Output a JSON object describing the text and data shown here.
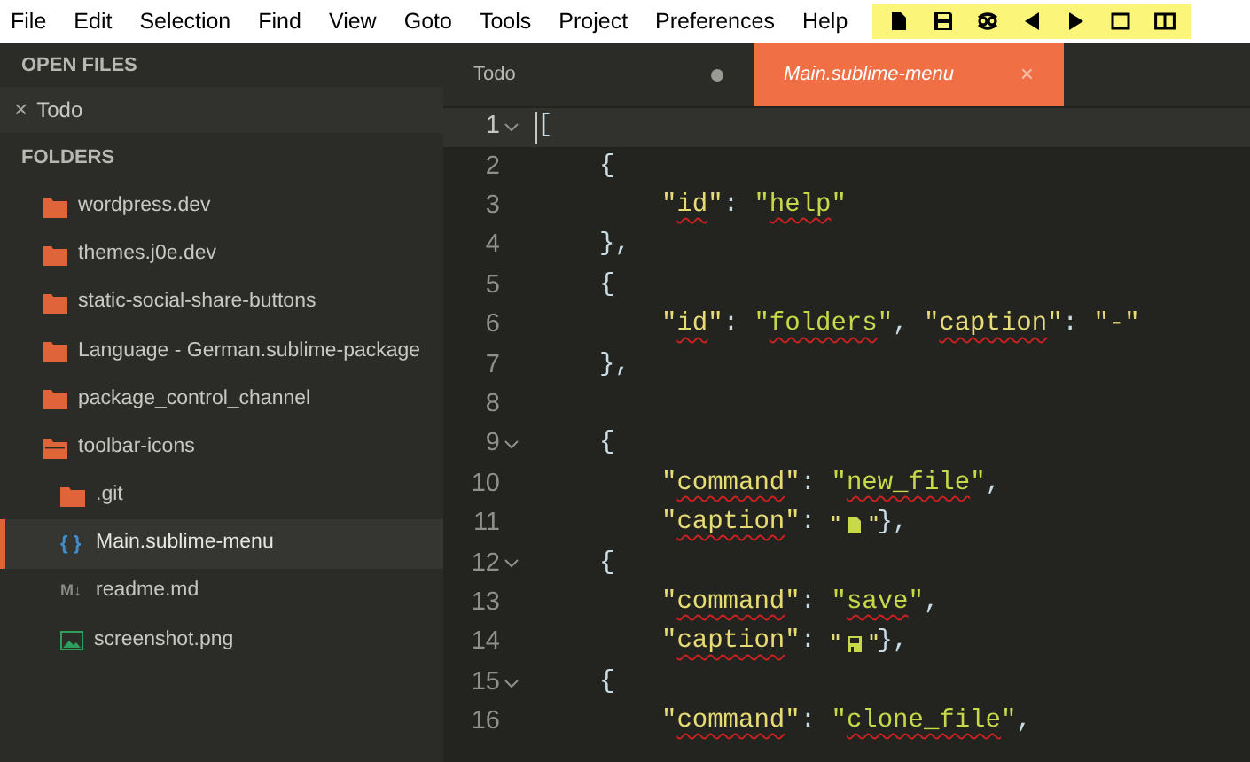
{
  "menu": [
    "File",
    "Edit",
    "Selection",
    "Find",
    "View",
    "Goto",
    "Tools",
    "Project",
    "Preferences",
    "Help"
  ],
  "toolbar": [
    {
      "kind": "new"
    },
    {
      "kind": "save"
    },
    {
      "kind": "clone"
    },
    {
      "kind": "prev"
    },
    {
      "kind": "next"
    },
    {
      "kind": "single"
    },
    {
      "kind": "split"
    }
  ],
  "sidebar": {
    "open_files_title": "OPEN FILES",
    "open_files": [
      {
        "close": "×",
        "name": "Todo"
      }
    ],
    "folders_title": "FOLDERS",
    "tree": [
      {
        "kind": "folder",
        "name": "wordpress.dev",
        "expanded": false,
        "selected": false
      },
      {
        "kind": "folder",
        "name": "themes.j0e.dev",
        "expanded": false,
        "selected": false
      },
      {
        "kind": "folder",
        "name": "static-social-share-buttons",
        "expanded": false,
        "selected": false
      },
      {
        "kind": "folder",
        "name": "Language - German.sublime-package",
        "expanded": false,
        "selected": false
      },
      {
        "kind": "folder",
        "name": "package_control_channel",
        "expanded": false,
        "selected": false
      },
      {
        "kind": "folder",
        "name": "toolbar-icons",
        "expanded": true,
        "selected": false,
        "children": [
          {
            "kind": "folder",
            "name": ".git",
            "expanded": false,
            "selected": false
          },
          {
            "kind": "code-file",
            "glyph": "{ }",
            "name": "Main.sublime-menu",
            "selected": true
          },
          {
            "kind": "markdown-file",
            "glyph": "M↓",
            "name": "readme.md",
            "selected": false
          },
          {
            "kind": "image-file",
            "name": "screenshot.png",
            "selected": false
          }
        ]
      }
    ]
  },
  "tabs": [
    {
      "label": "Todo",
      "selected": false,
      "modified": true
    },
    {
      "label": "Main.sublime-menu",
      "selected": true,
      "close": "×"
    }
  ],
  "editor": {
    "lines": [
      {
        "number": "1",
        "kind": "top",
        "foldable": true,
        "current": true,
        "tokens": [
          {
            "kind": "punct",
            "text": "["
          }
        ]
      },
      {
        "number": "2",
        "kind": "object",
        "foldable": false,
        "current": false,
        "tokens": [
          {
            "kind": "punct",
            "text": "{"
          }
        ]
      },
      {
        "number": "3",
        "kind": "member",
        "foldable": false,
        "current": false,
        "tokens": [
          {
            "kind": "key",
            "text": "\"id\""
          },
          {
            "kind": "punct",
            "text": ": "
          },
          {
            "kind": "string",
            "text": "\"help\""
          }
        ]
      },
      {
        "number": "4",
        "kind": "object",
        "foldable": false,
        "current": false,
        "tokens": [
          {
            "kind": "punct",
            "text": "},"
          }
        ]
      },
      {
        "number": "5",
        "kind": "object",
        "foldable": false,
        "current": false,
        "tokens": [
          {
            "kind": "punct",
            "text": "{"
          }
        ]
      },
      {
        "number": "6",
        "kind": "member",
        "foldable": false,
        "current": false,
        "tokens": [
          {
            "kind": "key",
            "text": "\"id\""
          },
          {
            "kind": "punct",
            "text": ": "
          },
          {
            "kind": "string",
            "text": "\"folders\""
          },
          {
            "kind": "punct",
            "text": ", "
          },
          {
            "kind": "key",
            "text": "\"caption\""
          },
          {
            "kind": "punct",
            "text": ": "
          },
          {
            "kind": "plain-string",
            "text": "\"-\""
          }
        ]
      },
      {
        "number": "7",
        "kind": "object",
        "foldable": false,
        "current": false,
        "tokens": [
          {
            "kind": "punct",
            "text": "},"
          }
        ]
      },
      {
        "number": "8",
        "kind": "top",
        "foldable": false,
        "current": false
      },
      {
        "number": "9",
        "kind": "object",
        "foldable": true,
        "current": false,
        "tokens": [
          {
            "kind": "punct",
            "text": "{"
          }
        ]
      },
      {
        "number": "10",
        "kind": "member",
        "foldable": false,
        "current": false,
        "tokens": [
          {
            "kind": "key",
            "text": "\"command\""
          },
          {
            "kind": "punct",
            "text": ": "
          },
          {
            "kind": "string",
            "text": "\"new_file\""
          },
          {
            "kind": "punct",
            "text": ","
          }
        ]
      },
      {
        "number": "11",
        "kind": "member",
        "foldable": false,
        "current": false,
        "tokens": [
          {
            "kind": "key",
            "text": "\"caption\""
          },
          {
            "kind": "punct",
            "text": ": "
          },
          {
            "kind": "file-glyph"
          },
          {
            "kind": "punct",
            "text": "},"
          }
        ]
      },
      {
        "number": "12",
        "kind": "object",
        "foldable": true,
        "current": false,
        "tokens": [
          {
            "kind": "punct",
            "text": "{"
          }
        ]
      },
      {
        "number": "13",
        "kind": "member",
        "foldable": false,
        "current": false,
        "tokens": [
          {
            "kind": "key",
            "text": "\"command\""
          },
          {
            "kind": "punct",
            "text": ": "
          },
          {
            "kind": "string",
            "text": "\"save\""
          },
          {
            "kind": "punct",
            "text": ","
          }
        ]
      },
      {
        "number": "14",
        "kind": "member",
        "foldable": false,
        "current": false,
        "tokens": [
          {
            "kind": "key",
            "text": "\"caption\""
          },
          {
            "kind": "punct",
            "text": ": "
          },
          {
            "kind": "save-glyph"
          },
          {
            "kind": "punct",
            "text": "},"
          }
        ]
      },
      {
        "number": "15",
        "kind": "object",
        "foldable": true,
        "current": false,
        "tokens": [
          {
            "kind": "punct",
            "text": "{"
          }
        ]
      },
      {
        "number": "16",
        "kind": "member",
        "foldable": false,
        "current": false,
        "tokens": [
          {
            "kind": "key",
            "text": "\"command\""
          },
          {
            "kind": "punct",
            "text": ": "
          },
          {
            "kind": "string",
            "text": "\"clone_file\""
          },
          {
            "kind": "punct",
            "text": ","
          }
        ]
      }
    ]
  }
}
